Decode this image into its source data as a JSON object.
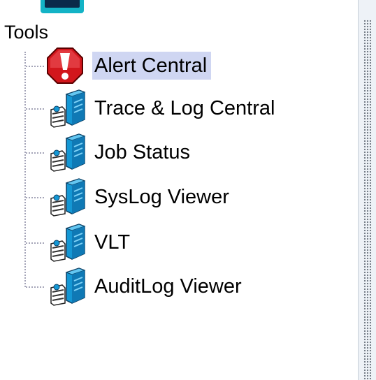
{
  "tree": {
    "group_label": "Tools",
    "items": [
      {
        "label": "Alert Central",
        "icon": "alert-icon",
        "selected": true
      },
      {
        "label": "Trace & Log Central",
        "icon": "server-icon",
        "selected": false
      },
      {
        "label": "Job Status",
        "icon": "server-icon",
        "selected": false
      },
      {
        "label": "SysLog Viewer",
        "icon": "server-icon",
        "selected": false
      },
      {
        "label": "VLT",
        "icon": "server-icon",
        "selected": false
      },
      {
        "label": "AuditLog Viewer",
        "icon": "server-icon",
        "selected": false
      }
    ]
  },
  "colors": {
    "selection": "#cfd6f2",
    "tree_line": "#a5a5b8",
    "alert_red": "#d2161c",
    "server_blue": "#1497d4"
  }
}
